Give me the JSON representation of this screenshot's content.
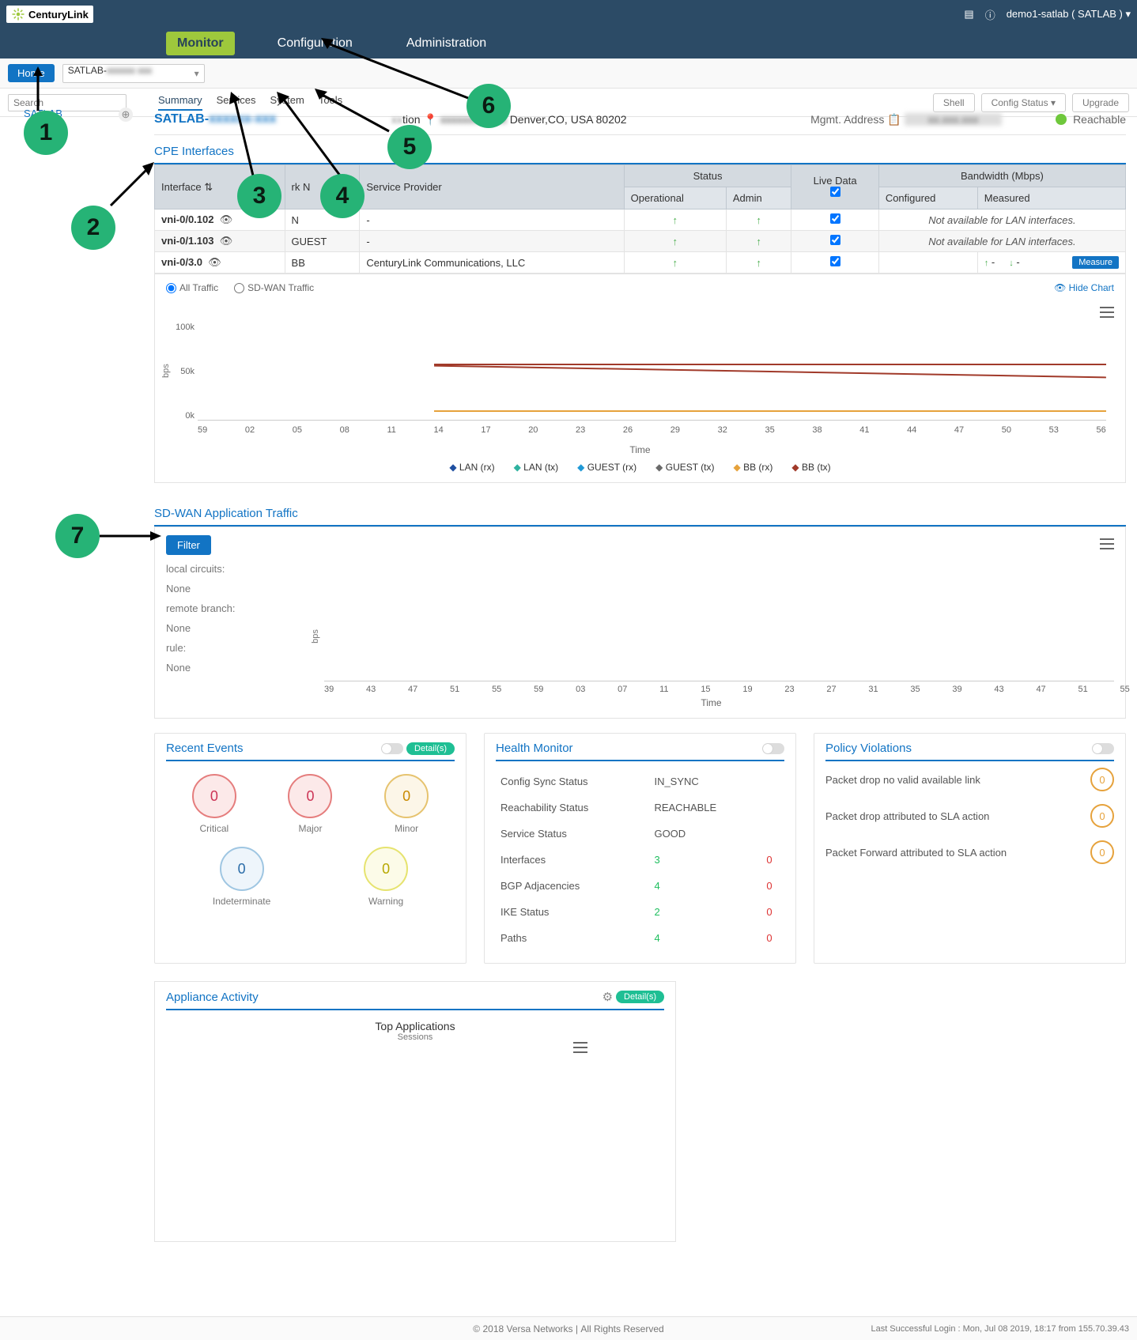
{
  "topbar": {
    "brand": "CenturyLink",
    "user": "demo1-satlab ( SATLAB )"
  },
  "nav": {
    "monitor": "Monitor",
    "configuration": "Configuration",
    "administration": "Administration"
  },
  "home": "Home",
  "device_select": "SATLAB-",
  "search_placeholder": "Search",
  "tabs": {
    "summary": "Summary",
    "services": "Services",
    "system": "System",
    "tools": "Tools"
  },
  "actions": {
    "shell": "Shell",
    "config_status": "Config Status ▾",
    "upgrade": "Upgrade"
  },
  "tree": {
    "item0": "SATLAB"
  },
  "device": {
    "name_prefix": "SATLAB-",
    "name_blur": "xxxxxx-xxx",
    "location_label": "tion",
    "location": "Denver,CO, USA 80202",
    "mgmt_label": "Mgmt. Address",
    "reachable": "Reachable"
  },
  "cpe": {
    "title": "CPE Interfaces",
    "cols": {
      "interface": "Interface",
      "network": "rk N",
      "sp": "Service Provider",
      "status": "Status",
      "operational": "Operational",
      "admin": "Admin",
      "live": "Live Data",
      "bw": "Bandwidth (Mbps)",
      "configured": "Configured",
      "measured": "Measured"
    },
    "na_lan": "Not available for LAN interfaces.",
    "measure": "Measure",
    "rows": [
      {
        "iface": "vni-0/0.102",
        "net": "N",
        "sp": "-"
      },
      {
        "iface": "vni-0/1.103",
        "net": "GUEST",
        "sp": "-"
      },
      {
        "iface": "vni-0/3.0",
        "net": "BB",
        "sp": "CenturyLink Communications, LLC"
      }
    ]
  },
  "traffic_radio": {
    "all": "All Traffic",
    "sdwan": "SD-WAN Traffic",
    "hide": "Hide Chart"
  },
  "chart_data": {
    "type": "line",
    "ylabel": "bps",
    "xlabel": "Time",
    "yticks": [
      "100k",
      "50k",
      "0k"
    ],
    "xticks": [
      "59",
      "02",
      "05",
      "08",
      "11",
      "14",
      "17",
      "20",
      "23",
      "26",
      "29",
      "32",
      "35",
      "38",
      "41",
      "44",
      "47",
      "50",
      "53",
      "56"
    ],
    "series": [
      {
        "name": "LAN (rx)",
        "color": "#1f4fa0"
      },
      {
        "name": "LAN (tx)",
        "color": "#2fb2a0"
      },
      {
        "name": "GUEST (rx)",
        "color": "#2099d6"
      },
      {
        "name": "GUEST (tx)",
        "color": "#6a6a6a"
      },
      {
        "name": "BB (rx)",
        "color": "#e6a23c",
        "approx_values": [
          10,
          10,
          10,
          10,
          10,
          10,
          10,
          10,
          10,
          10,
          10,
          11,
          10,
          10,
          10
        ]
      },
      {
        "name": "BB (tx)",
        "color": "#a13a2a",
        "approx_values": [
          60,
          57,
          55,
          54,
          55,
          54,
          55,
          55,
          56,
          54,
          52,
          50,
          50,
          50,
          50
        ]
      }
    ]
  },
  "sdwan": {
    "title": "SD-WAN Application Traffic",
    "filter": "Filter",
    "local": "local circuits:",
    "remote": "remote branch:",
    "rule": "rule:",
    "none": "None",
    "ylabel": "bps",
    "xlabel": "Time",
    "xticks": [
      "39",
      "43",
      "47",
      "51",
      "55",
      "59",
      "03",
      "07",
      "11",
      "15",
      "19",
      "23",
      "27",
      "31",
      "35",
      "39",
      "43",
      "47",
      "51",
      "55"
    ]
  },
  "events": {
    "title": "Recent Events",
    "details": "Detail(s)",
    "critical": "Critical",
    "major": "Major",
    "minor": "Minor",
    "indet": "Indeterminate",
    "warning": "Warning",
    "zero": "0"
  },
  "health": {
    "title": "Health Monitor",
    "rows": [
      {
        "k": "Config Sync Status",
        "v": "IN_SYNC"
      },
      {
        "k": "Reachability Status",
        "v": "REACHABLE"
      },
      {
        "k": "Service Status",
        "v": "GOOD"
      },
      {
        "k": "Interfaces",
        "g": "3",
        "r": "0"
      },
      {
        "k": "BGP Adjacencies",
        "g": "4",
        "r": "0"
      },
      {
        "k": "IKE Status",
        "g": "2",
        "r": "0"
      },
      {
        "k": "Paths",
        "g": "4",
        "r": "0"
      }
    ]
  },
  "pv": {
    "title": "Policy Violations",
    "rows": [
      "Packet drop no valid available link",
      "Packet drop attributed to SLA action",
      "Packet Forward attributed to SLA action"
    ],
    "zero": "0"
  },
  "activity": {
    "title": "Appliance Activity",
    "details": "Detail(s)",
    "top_apps": "Top Applications",
    "sessions": "Sessions"
  },
  "footer": {
    "copy": "© 2018 Versa Networks",
    "rights": "All Rights Reserved",
    "last": "Last Successful Login : Mon, Jul 08 2019, 18:17 from 155.70.39.43"
  }
}
